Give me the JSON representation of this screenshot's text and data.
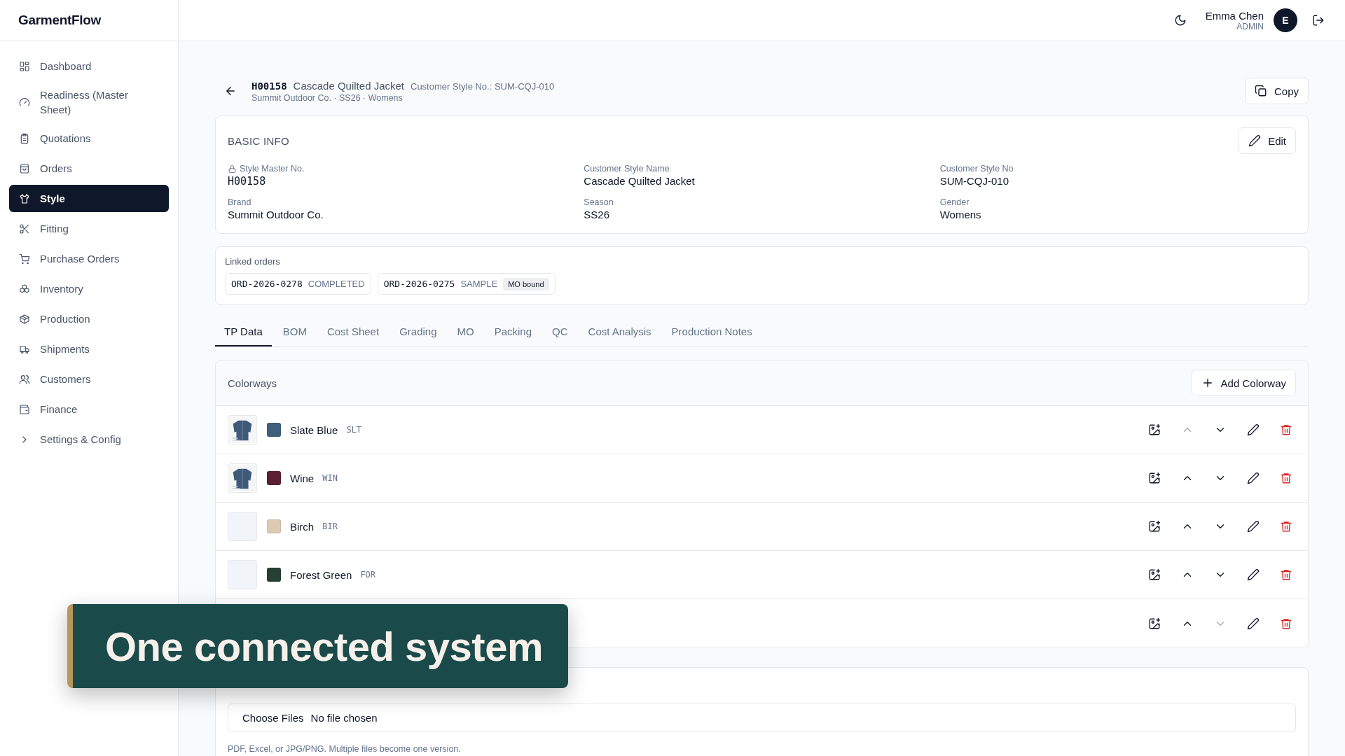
{
  "app": {
    "logo": "GarmentFlow"
  },
  "sidebar": {
    "items": [
      {
        "label": "Dashboard",
        "selected": false,
        "kind": "link"
      },
      {
        "label": "Readiness (Master Sheet)",
        "selected": false,
        "kind": "link"
      },
      {
        "label": "Quotations",
        "selected": false,
        "kind": "link"
      },
      {
        "label": "Orders",
        "selected": false,
        "kind": "link"
      },
      {
        "label": "Style",
        "selected": true,
        "kind": "link"
      },
      {
        "label": "Fitting",
        "selected": false,
        "kind": "link"
      },
      {
        "label": "Purchase Orders",
        "selected": false,
        "kind": "link"
      },
      {
        "label": "Inventory",
        "selected": false,
        "kind": "link"
      },
      {
        "label": "Production",
        "selected": false,
        "kind": "link"
      },
      {
        "label": "Shipments",
        "selected": false,
        "kind": "link"
      },
      {
        "label": "Customers",
        "selected": false,
        "kind": "link"
      },
      {
        "label": "Finance",
        "selected": false,
        "kind": "link"
      },
      {
        "label": "Settings & Config",
        "selected": false,
        "kind": "group",
        "expanded": false
      }
    ]
  },
  "topbar": {
    "user_name": "Emma Chen",
    "user_role": "ADMIN",
    "avatar": "E"
  },
  "style_header": {
    "code": "H00158",
    "name": "Cascade Quilted Jacket",
    "customer_style": "Customer Style No.: SUM-CQJ-010",
    "subtitle": "Summit Outdoor Co. · SS26 · Womens",
    "copy_button": "Copy"
  },
  "basic_info": {
    "title": "BASIC INFO",
    "edit_button": "Edit",
    "fields": [
      {
        "label": "Style Master No.",
        "value": "H00158",
        "kind": "locked"
      },
      {
        "label": "Customer Style Name",
        "value": "Cascade Quilted Jacket",
        "kind": "text"
      },
      {
        "label": "Customer Style No",
        "value": "SUM-CQJ-010",
        "kind": "text"
      },
      {
        "label": "Brand",
        "value": "Summit Outdoor Co.",
        "kind": "text"
      },
      {
        "label": "Season",
        "value": "SS26",
        "kind": "text"
      },
      {
        "label": "Gender",
        "value": "Womens",
        "kind": "text"
      }
    ]
  },
  "linked_orders": {
    "title": "Linked orders",
    "orders": [
      {
        "number": "ORD-2026-0278",
        "status": "COMPLETED"
      },
      {
        "number": "ORD-2026-0275",
        "status": "SAMPLE",
        "badge": "MO bound"
      }
    ]
  },
  "tabs": [
    {
      "label": "TP Data",
      "selected": true
    },
    {
      "label": "BOM",
      "selected": false
    },
    {
      "label": "Cost Sheet",
      "selected": false
    },
    {
      "label": "Grading",
      "selected": false
    },
    {
      "label": "MO",
      "selected": false
    },
    {
      "label": "Packing",
      "selected": false
    },
    {
      "label": "QC",
      "selected": false
    },
    {
      "label": "Cost Analysis",
      "selected": false
    },
    {
      "label": "Production Notes",
      "selected": false
    }
  ],
  "colorways": {
    "title": "Colorways",
    "add_button": "Add Colorway",
    "rows": [
      {
        "name": "Slate Blue",
        "code": "SLT",
        "color": "#3f5f7a",
        "has_image": true,
        "up_disabled": true,
        "down_disabled": false
      },
      {
        "name": "Wine",
        "code": "WIN",
        "color": "#5c1f33",
        "has_image": true,
        "up_disabled": false,
        "down_disabled": false
      },
      {
        "name": "Birch",
        "code": "BIR",
        "color": "#dccbb2",
        "has_image": false,
        "up_disabled": false,
        "down_disabled": false
      },
      {
        "name": "Forest Green",
        "code": "FOR",
        "color": "#263f35",
        "has_image": false,
        "up_disabled": false,
        "down_disabled": false
      },
      {
        "up_disabled": false,
        "down_disabled": true
      }
    ]
  },
  "upload": {
    "button": "Choose Files",
    "value": "No file chosen",
    "help": "PDF, Excel, or JPG/PNG. Multiple files become one version."
  },
  "banner": {
    "text": "One connected system"
  }
}
